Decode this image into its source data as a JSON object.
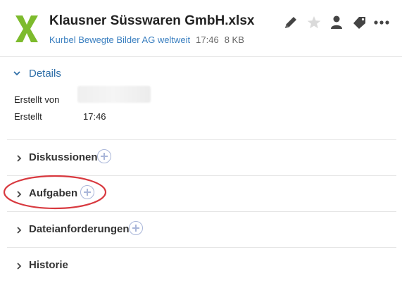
{
  "file": {
    "title": "Klausner Süsswaren GmbH.xlsx",
    "location": "Kurbel Bewegte Bilder AG weltweit",
    "time": "17:46",
    "size": "8 KB",
    "icon": "excel-x-icon"
  },
  "toolbar": {
    "icons": [
      "pencil-icon",
      "star-icon",
      "user-icon",
      "tag-icon",
      "more-icon"
    ]
  },
  "details": {
    "label": "Details",
    "created_by_label": "Erstellt von",
    "created_label": "Erstellt",
    "created_value": "17:46"
  },
  "sections": [
    {
      "label": "Diskussionen",
      "has_add": true
    },
    {
      "label": "Aufgaben",
      "has_add": true,
      "highlighted": true
    },
    {
      "label": "Dateianforderungen",
      "has_add": true
    },
    {
      "label": "Historie",
      "has_add": false
    }
  ],
  "colors": {
    "accent": "#2f6fa8",
    "link": "#3a7fc0",
    "excel_green": "#7dbb2d",
    "add_button": "#a9b6d9",
    "highlight": "#d8393f"
  }
}
